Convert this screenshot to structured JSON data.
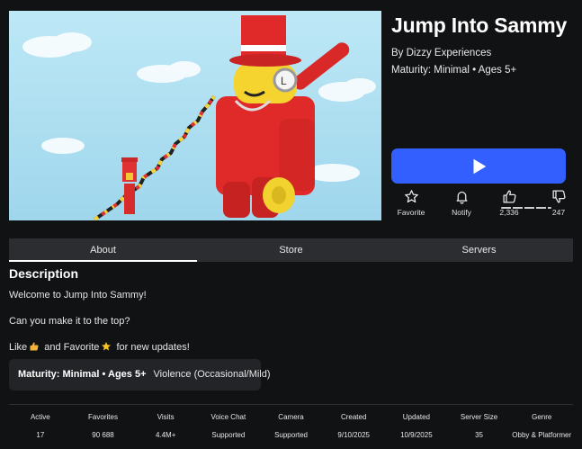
{
  "game": {
    "title": "Jump Into Sammy",
    "creator_prefix": "By ",
    "creator": "Dizzy Experiences",
    "maturity": "Maturity: Minimal • Ages 5+"
  },
  "actions": {
    "favorite": "Favorite",
    "notify": "Notify",
    "upvotes": "2,336",
    "downvotes": "247"
  },
  "tabs": [
    "About",
    "Store",
    "Servers"
  ],
  "description": {
    "heading": "Description",
    "line1": "Welcome to Jump Into Sammy!",
    "line2": "Can you make it to the top?",
    "line3_a": "Like",
    "line3_b": " and Favorite",
    "line3_c": " for new updates!"
  },
  "maturity_box": {
    "label": "Maturity: Minimal • Ages 5+",
    "descriptor": "Violence (Occasional/Mild)"
  },
  "stats": [
    {
      "label": "Active",
      "value": "17"
    },
    {
      "label": "Favorites",
      "value": "90 688"
    },
    {
      "label": "Visits",
      "value": "4.4M+"
    },
    {
      "label": "Voice Chat",
      "value": "Supported"
    },
    {
      "label": "Camera",
      "value": "Supported"
    },
    {
      "label": "Created",
      "value": "9/10/2025"
    },
    {
      "label": "Updated",
      "value": "10/9/2025"
    },
    {
      "label": "Server Size",
      "value": "35"
    },
    {
      "label": "Genre",
      "value": "Obby & Platformer"
    }
  ],
  "colors": {
    "background": "#111214",
    "play_button": "#335fff",
    "tab_bar": "#2b2d31",
    "panel": "#232428"
  },
  "icons": {
    "play": "play-icon",
    "favorite": "star-icon",
    "notify": "bell-icon",
    "upvote": "thumbs-up-icon",
    "downvote": "thumbs-down-icon"
  }
}
